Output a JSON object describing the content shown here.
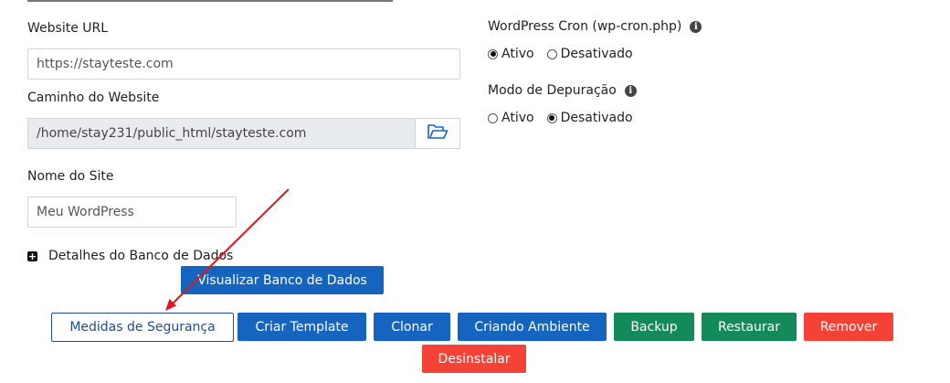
{
  "left": {
    "website_url_label": "Website URL",
    "website_url_value": "https://stayteste.com",
    "path_label": "Caminho do Website",
    "path_value": "/home/stay231/public_html/stayteste.com",
    "site_name_label": "Nome do Site",
    "site_name_value": "Meu WordPress",
    "db_details_label": "Detalhes do Banco de Dados",
    "view_db_button": "Visualizar Banco de Dados"
  },
  "right": {
    "cron_label": "WordPress Cron (wp-cron.php)",
    "cron_options": [
      "Ativo",
      "Desativado"
    ],
    "cron_selected": "Ativo",
    "debug_label": "Modo de Depuração",
    "debug_options": [
      "Ativo",
      "Desativado"
    ],
    "debug_selected": "Desativado"
  },
  "actions": {
    "security": "Medidas de Segurança",
    "template": "Criar Template",
    "clone": "Clonar",
    "staging": "Criando Ambiente",
    "backup": "Backup",
    "restore": "Restaurar",
    "remove": "Remover",
    "uninstall": "Desinstalar"
  },
  "colors": {
    "primary": "#1565c0",
    "success": "#138a5a",
    "danger": "#f44336",
    "arrow": "#e0161b"
  },
  "icons": {
    "folder": "folder-open-icon",
    "info": "info-icon",
    "expand": "plus-square-icon"
  }
}
